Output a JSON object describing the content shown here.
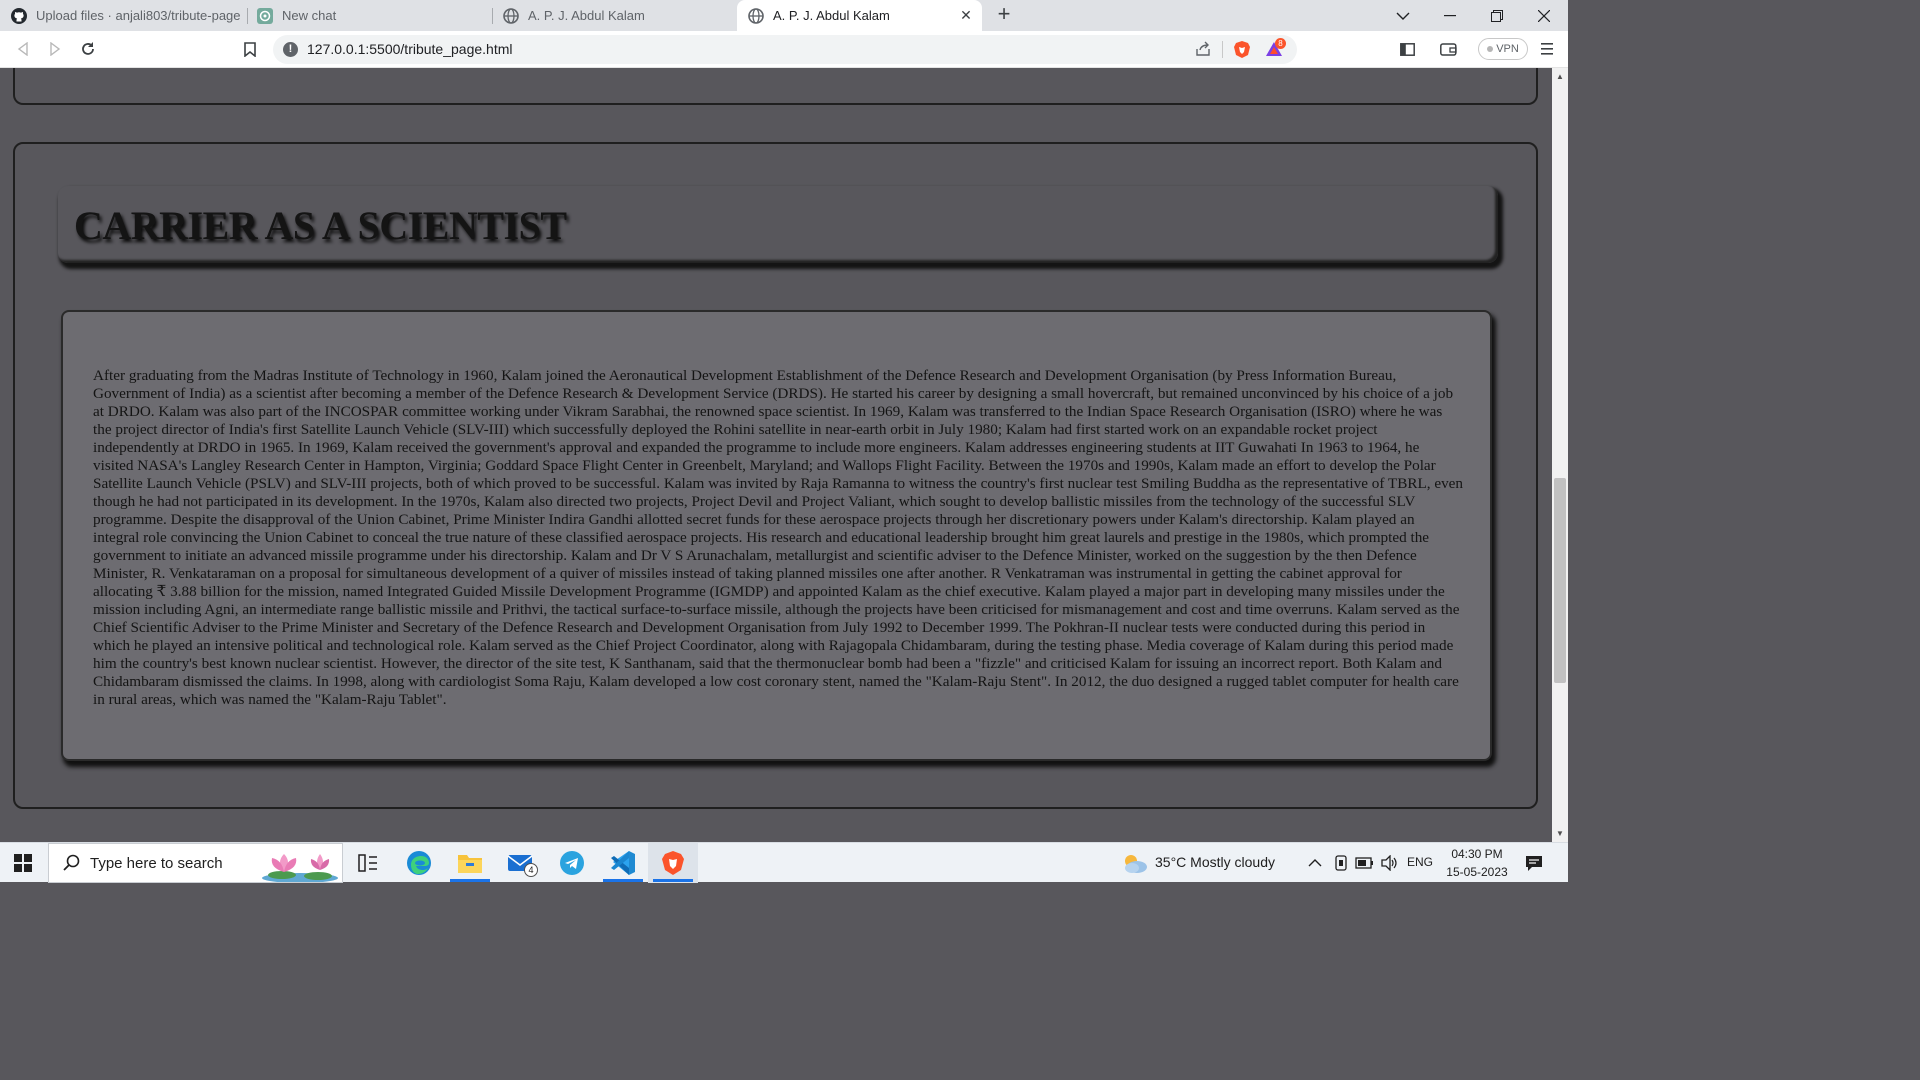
{
  "browser": {
    "tabs": [
      {
        "label": "Upload files · anjali803/tribute-page",
        "icon": "github-icon",
        "active": false
      },
      {
        "label": "New chat",
        "icon": "chatgpt-icon",
        "active": false
      },
      {
        "label": "A. P. J. Abdul Kalam",
        "icon": "globe-icon",
        "active": false
      },
      {
        "label": "A. P. J. Abdul Kalam",
        "icon": "globe-icon",
        "active": true
      }
    ],
    "url": "127.0.0.1:5500/tribute_page.html",
    "vpn_label": "VPN",
    "notification_count": "8"
  },
  "page": {
    "heading": "CARRIER AS A SCIENTIST",
    "paragraph": "After graduating from the Madras Institute of Technology in 1960, Kalam joined the Aeronautical Development Establishment of the Defence Research and Development Organisation (by Press Information Bureau, Government of India) as a scientist after becoming a member of the Defence Research & Development Service (DRDS). He started his career by designing a small hovercraft, but remained unconvinced by his choice of a job at DRDO. Kalam was also part of the INCOSPAR committee working under Vikram Sarabhai, the renowned space scientist. In 1969, Kalam was transferred to the Indian Space Research Organisation (ISRO) where he was the project director of India's first Satellite Launch Vehicle (SLV-III) which successfully deployed the Rohini satellite in near-earth orbit in July 1980; Kalam had first started work on an expandable rocket project independently at DRDO in 1965. In 1969, Kalam received the government's approval and expanded the programme to include more engineers. Kalam addresses engineering students at IIT Guwahati In 1963 to 1964, he visited NASA's Langley Research Center in Hampton, Virginia; Goddard Space Flight Center in Greenbelt, Maryland; and Wallops Flight Facility. Between the 1970s and 1990s, Kalam made an effort to develop the Polar Satellite Launch Vehicle (PSLV) and SLV-III projects, both of which proved to be successful. Kalam was invited by Raja Ramanna to witness the country's first nuclear test Smiling Buddha as the representative of TBRL, even though he had not participated in its development. In the 1970s, Kalam also directed two projects, Project Devil and Project Valiant, which sought to develop ballistic missiles from the technology of the successful SLV programme. Despite the disapproval of the Union Cabinet, Prime Minister Indira Gandhi allotted secret funds for these aerospace projects through her discretionary powers under Kalam's directorship. Kalam played an integral role convincing the Union Cabinet to conceal the true nature of these classified aerospace projects. His research and educational leadership brought him great laurels and prestige in the 1980s, which prompted the government to initiate an advanced missile programme under his directorship. Kalam and Dr V S Arunachalam, metallurgist and scientific adviser to the Defence Minister, worked on the suggestion by the then Defence Minister, R. Venkataraman on a proposal for simultaneous development of a quiver of missiles instead of taking planned missiles one after another. R Venkatraman was instrumental in getting the cabinet approval for allocating ₹ 3.88 billion for the mission, named Integrated Guided Missile Development Programme (IGMDP) and appointed Kalam as the chief executive. Kalam played a major part in developing many missiles under the mission including Agni, an intermediate range ballistic missile and Prithvi, the tactical surface-to-surface missile, although the projects have been criticised for mismanagement and cost and time overruns. Kalam served as the Chief Scientific Adviser to the Prime Minister and Secretary of the Defence Research and Development Organisation from July 1992 to December 1999. The Pokhran-II nuclear tests were conducted during this period in which he played an intensive political and technological role. Kalam served as the Chief Project Coordinator, along with Rajagopala Chidambaram, during the testing phase. Media coverage of Kalam during this period made him the country's best known nuclear scientist. However, the director of the site test, K Santhanam, said that the thermonuclear bomb had been a \"fizzle\" and criticised Kalam for issuing an incorrect report. Both Kalam and Chidambaram dismissed the claims. In 1998, along with cardiologist Soma Raju, Kalam developed a low cost coronary stent, named the \"Kalam-Raju Stent\". In 2012, the duo designed a rugged tablet computer for health care in rural areas, which was named the \"Kalam-Raju Tablet\"."
  },
  "taskbar": {
    "search_placeholder": "Type here to search",
    "mail_badge": "4",
    "weather": "35°C  Mostly cloudy",
    "language": "ENG",
    "time": "04:30 PM",
    "date": "15-05-2023"
  },
  "colors": {
    "page_bg": "#58575c",
    "paragraph_bg": "#6d6c71",
    "brave_orange": "#fb542b",
    "taskbar_accent": "#1a73e8"
  }
}
